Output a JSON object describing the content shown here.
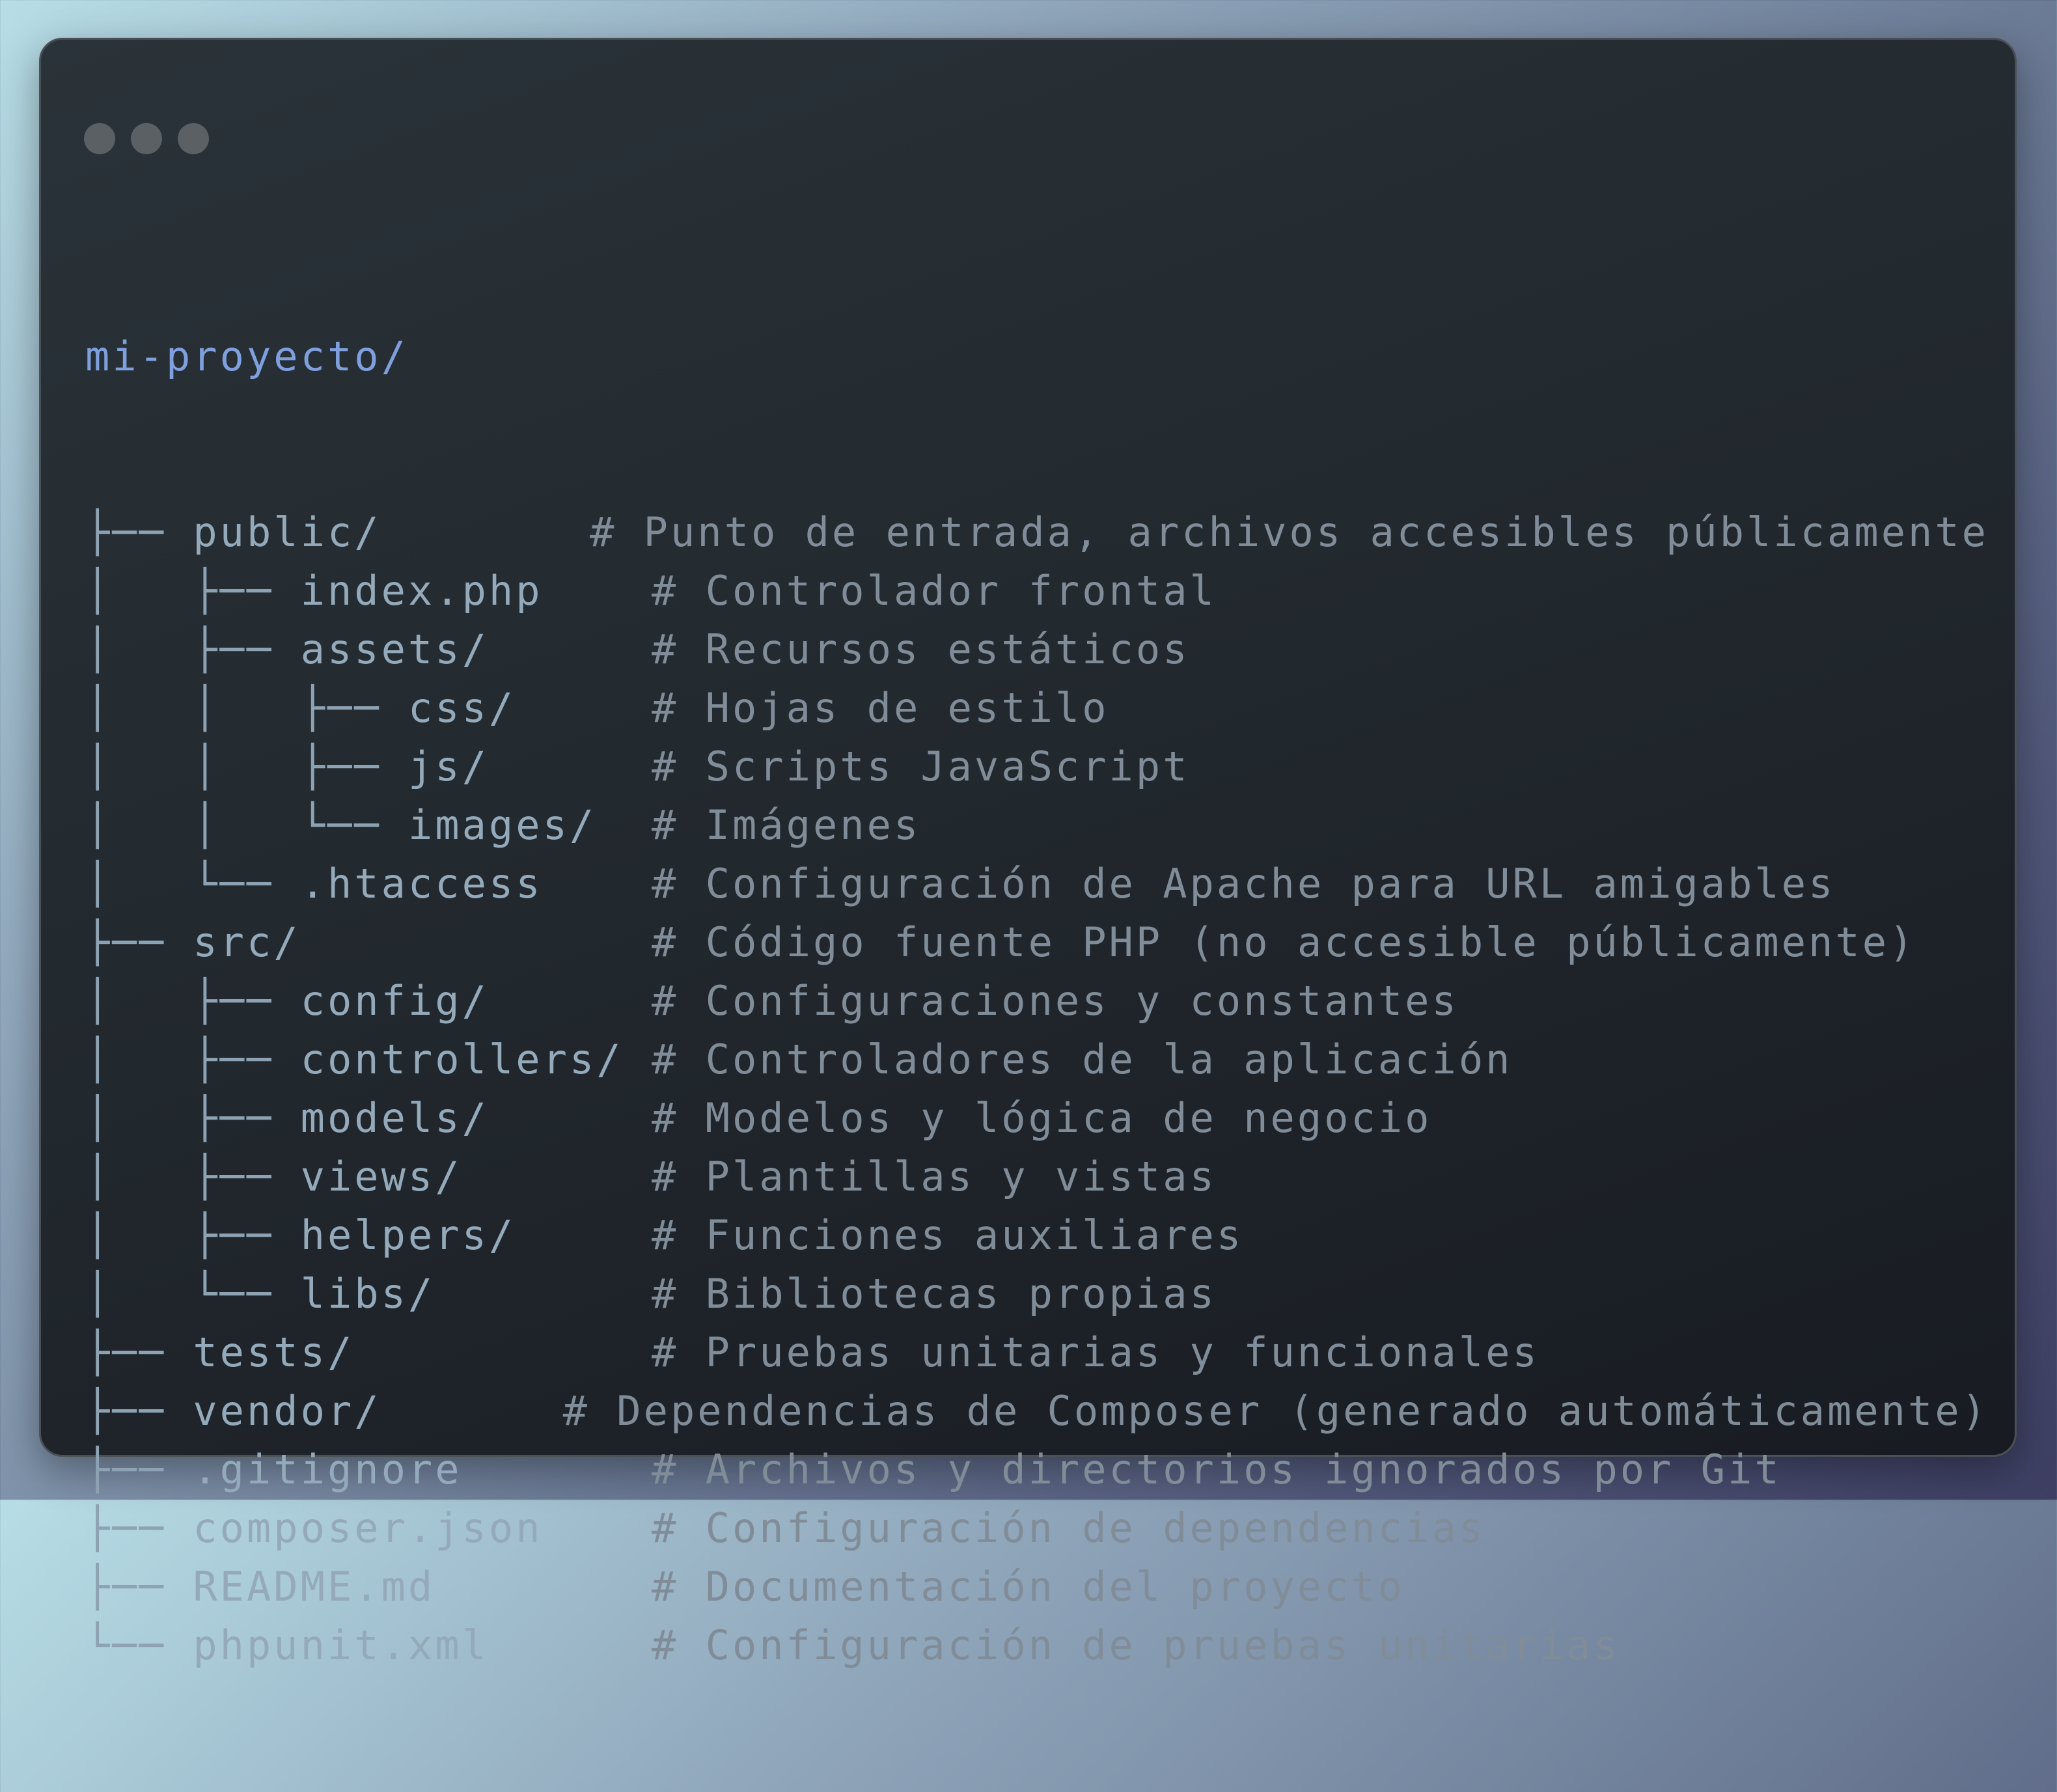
{
  "window": {
    "controls": [
      "close-dot",
      "minimize-dot",
      "maximize-dot"
    ]
  },
  "tree": {
    "root": "mi-proyecto/",
    "lines": [
      {
        "guide": "├── ",
        "name": "public/",
        "comment": "# Punto de entrada, archivos accesibles públicamente"
      },
      {
        "guide": "│   ├── ",
        "name": "index.php",
        "comment": "# Controlador frontal"
      },
      {
        "guide": "│   ├── ",
        "name": "assets/",
        "comment": "# Recursos estáticos"
      },
      {
        "guide": "│   │   ├── ",
        "name": "css/",
        "comment": "# Hojas de estilo"
      },
      {
        "guide": "│   │   ├── ",
        "name": "js/",
        "comment": "# Scripts JavaScript"
      },
      {
        "guide": "│   │   └── ",
        "name": "images/",
        "comment": "# Imágenes"
      },
      {
        "guide": "│   └── ",
        "name": ".htaccess",
        "comment": "# Configuración de Apache para URL amigables"
      },
      {
        "guide": "├── ",
        "name": "src/",
        "comment": "# Código fuente PHP (no accesible públicamente)"
      },
      {
        "guide": "│   ├── ",
        "name": "config/",
        "comment": "# Configuraciones y constantes"
      },
      {
        "guide": "│   ├── ",
        "name": "controllers/",
        "comment": "# Controladores de la aplicación"
      },
      {
        "guide": "│   ├── ",
        "name": "models/",
        "comment": "# Modelos y lógica de negocio"
      },
      {
        "guide": "│   ├── ",
        "name": "views/",
        "comment": "# Plantillas y vistas"
      },
      {
        "guide": "│   ├── ",
        "name": "helpers/",
        "comment": "# Funciones auxiliares"
      },
      {
        "guide": "│   └── ",
        "name": "libs/",
        "comment": "# Bibliotecas propias"
      },
      {
        "guide": "├── ",
        "name": "tests/",
        "comment": "# Pruebas unitarias y funcionales"
      },
      {
        "guide": "├── ",
        "name": "vendor/",
        "comment": "# Dependencias de Composer (generado automáticamente)"
      },
      {
        "guide": "├── ",
        "name": ".gitignore",
        "comment": "# Archivos y directorios ignorados por Git"
      },
      {
        "guide": "├── ",
        "name": "composer.json",
        "comment": "# Configuración de dependencias"
      },
      {
        "guide": "├── ",
        "name": "README.md",
        "comment": "# Documentación del proyecto"
      },
      {
        "guide": "└── ",
        "name": "phpunit.xml",
        "comment": "# Configuración de pruebas unitarias"
      }
    ]
  },
  "colors": {
    "root": "#7f9fdd",
    "tree_text": "#94a9b9",
    "comment": "#808d99",
    "window_bg": "#22292f",
    "dot": "#5b6064"
  }
}
